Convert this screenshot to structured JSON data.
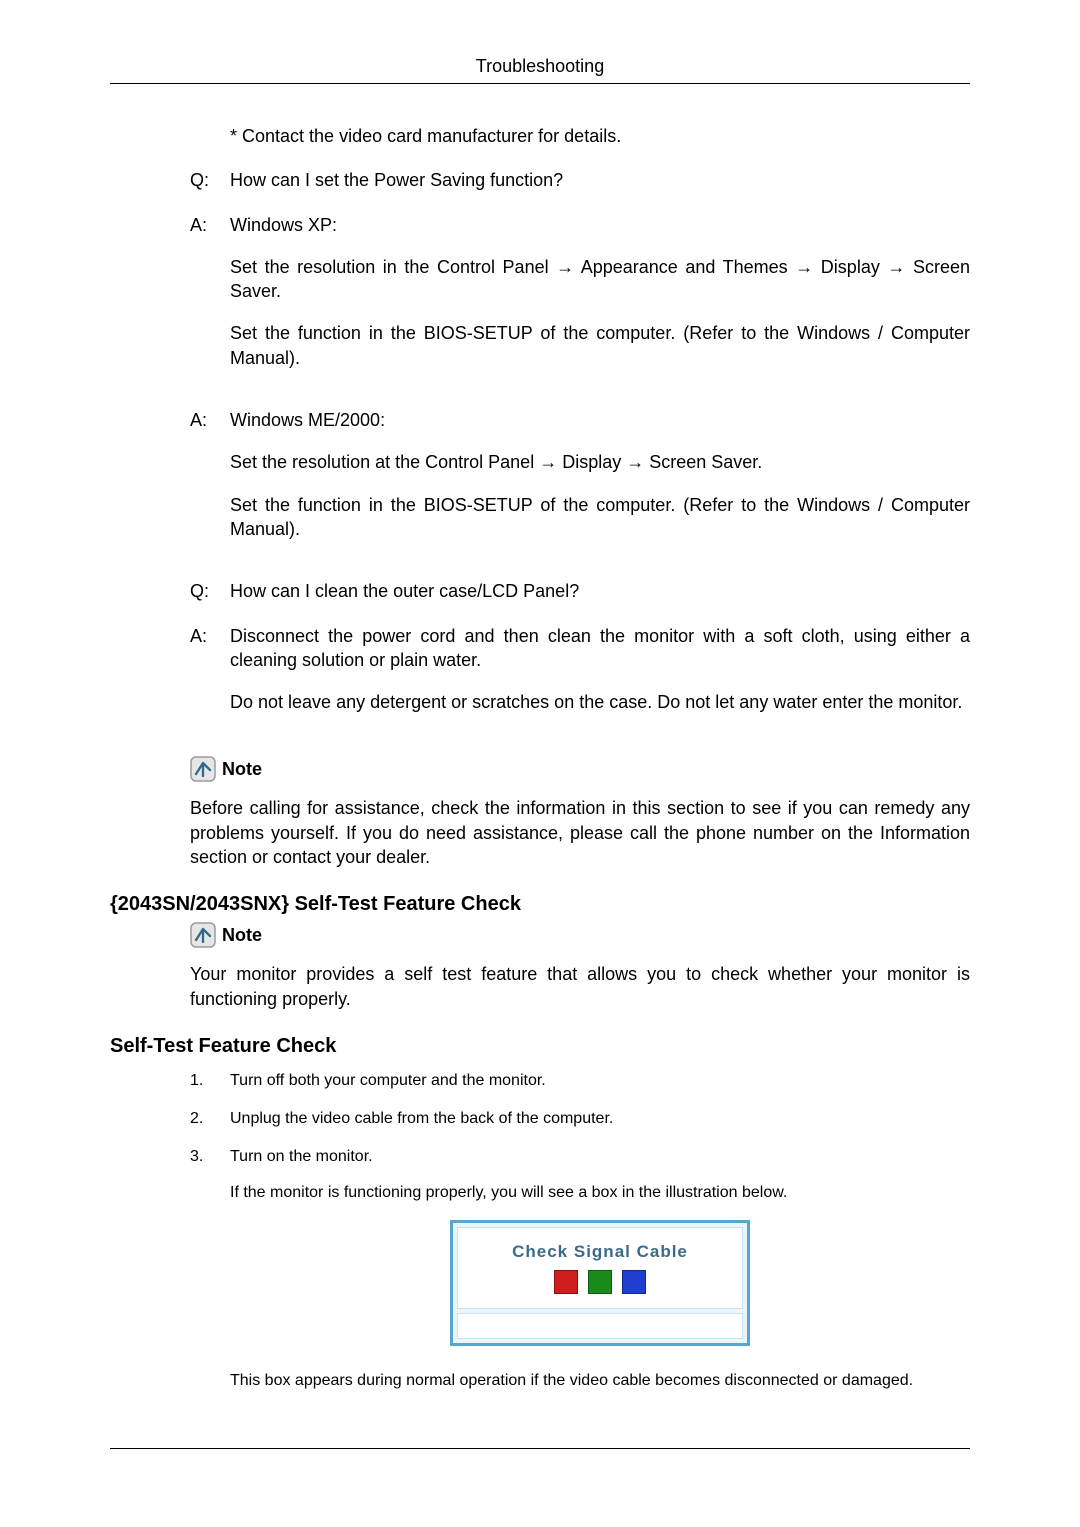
{
  "header": {
    "title": "Troubleshooting"
  },
  "qa": [
    {
      "label": "",
      "text": "* Contact the video card manufacturer for details."
    },
    {
      "label": "Q:",
      "text": "How can I set the Power Saving function?"
    },
    {
      "label": "A:",
      "paragraphs": [
        "Windows XP:",
        "Set the resolution in the Control Panel → Appearance and Themes → Display → Screen Saver.",
        "Set the function in the BIOS-SETUP of the computer. (Refer to the Windows / Computer Manual)."
      ]
    },
    {
      "label": "A:",
      "paragraphs": [
        "Windows ME/2000:",
        "Set the resolution at the Control Panel → Display → Screen Saver.",
        "Set the function in the BIOS-SETUP of the computer. (Refer to the Windows / Computer Manual)."
      ]
    },
    {
      "label": "Q:",
      "text": "How can I clean the outer case/LCD Panel?"
    },
    {
      "label": "A:",
      "paragraphs": [
        "Disconnect the power cord and then clean the monitor with a soft cloth, using either a cleaning solution or plain water.",
        "Do not leave any detergent or scratches on the case. Do not let any water enter the monitor."
      ]
    }
  ],
  "note1": {
    "label": "Note",
    "body": "Before calling for assistance, check the information in this section to see if you can remedy any problems yourself. If you do need assistance, please call the phone number on the Information section or contact your dealer."
  },
  "section1": {
    "heading": "{2043SN/2043SNX} Self-Test Feature Check"
  },
  "note2": {
    "label": "Note",
    "body": "Your monitor provides a self test feature that allows you to check whether your monitor is functioning properly."
  },
  "section2": {
    "heading": "Self-Test Feature Check"
  },
  "steps": [
    {
      "num": "1.",
      "text": "Turn off both your computer and the monitor."
    },
    {
      "num": "2.",
      "text": "Unplug the video cable from the back of the computer."
    },
    {
      "num": "3.",
      "paragraphs": [
        "Turn on the monitor.",
        "If the monitor is functioning properly, you will see a box in the illustration below."
      ],
      "after_box": "This box appears during normal operation if the video cable becomes disconnected or damaged."
    }
  ],
  "signal_box": {
    "title": "Check Signal Cable"
  }
}
